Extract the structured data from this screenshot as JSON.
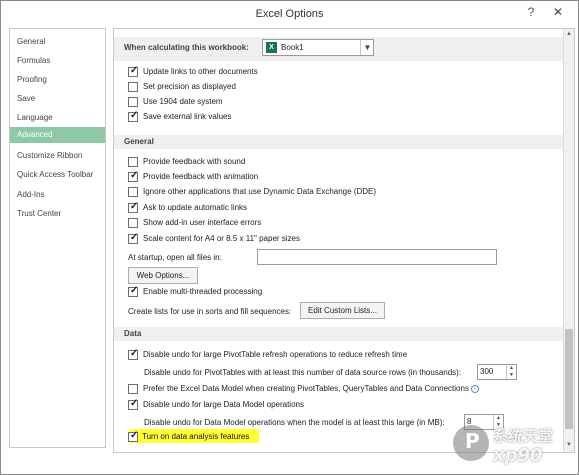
{
  "window": {
    "title": "Excel Options",
    "help_label": "?",
    "close_label": "✕"
  },
  "sidebar": {
    "items": [
      {
        "label": "General",
        "active": false
      },
      {
        "label": "Formulas",
        "active": false
      },
      {
        "label": "Proofing",
        "active": false
      },
      {
        "label": "Save",
        "active": false
      },
      {
        "label": "Language",
        "active": false
      },
      {
        "label": "Advanced",
        "active": true
      },
      {
        "label": "Customize Ribbon",
        "active": false
      },
      {
        "label": "Quick Access Toolbar",
        "active": false
      },
      {
        "label": "Add-Ins",
        "active": false
      },
      {
        "label": "Trust Center",
        "active": false
      }
    ]
  },
  "workbook_section": {
    "label": "When calculating this workbook:",
    "selected_workbook": "Book1",
    "options": [
      {
        "label": "Update links to other documents",
        "checked": true
      },
      {
        "label": "Set precision as displayed",
        "checked": false
      },
      {
        "label": "Use 1904 date system",
        "checked": false
      },
      {
        "label": "Save external link values",
        "checked": true
      }
    ]
  },
  "general_section": {
    "header": "General",
    "options": [
      {
        "label": "Provide feedback with sound",
        "checked": false
      },
      {
        "label": "Provide feedback with animation",
        "checked": true
      },
      {
        "label": "Ignore other applications that use Dynamic Data Exchange (DDE)",
        "checked": false
      },
      {
        "label": "Ask to update automatic links",
        "checked": true
      },
      {
        "label": "Show add-in user interface errors",
        "checked": false
      },
      {
        "label": "Scale content for A4 or 8.5 x 11\" paper sizes",
        "checked": true
      }
    ],
    "startup_label": "At startup, open all files in:",
    "startup_value": "",
    "web_options_label": "Web Options...",
    "multithread": {
      "label": "Enable multi-threaded processing",
      "checked": true
    },
    "custom_lists_label": "Create lists for use in sorts and fill sequences:",
    "edit_custom_lists_label": "Edit Custom Lists..."
  },
  "data_section": {
    "header": "Data",
    "options": [
      {
        "label": "Disable undo for large PivotTable refresh operations to reduce refresh time",
        "checked": true
      },
      {
        "label": "Prefer the Excel Data Model when creating PivotTables, QueryTables and Data Connections",
        "checked": false
      },
      {
        "label": "Disable undo for large Data Model operations",
        "checked": true
      },
      {
        "label": "Turn on data analysis features",
        "checked": true
      }
    ],
    "pivot_rows_label": "Disable undo for PivotTables with at least this number of data source rows (in thousands):",
    "pivot_rows_value": "300",
    "model_mb_label": "Disable undo for Data Model operations when the model is at least this large (in MB):",
    "model_mb_value": "8"
  },
  "watermark": {
    "glyph": "P",
    "text_cn": "系统天堂",
    "text_en": "xp90"
  },
  "colors": {
    "active_nav": "#8fc8a6",
    "highlight": "#ffff33",
    "excel_green": "#207245"
  }
}
